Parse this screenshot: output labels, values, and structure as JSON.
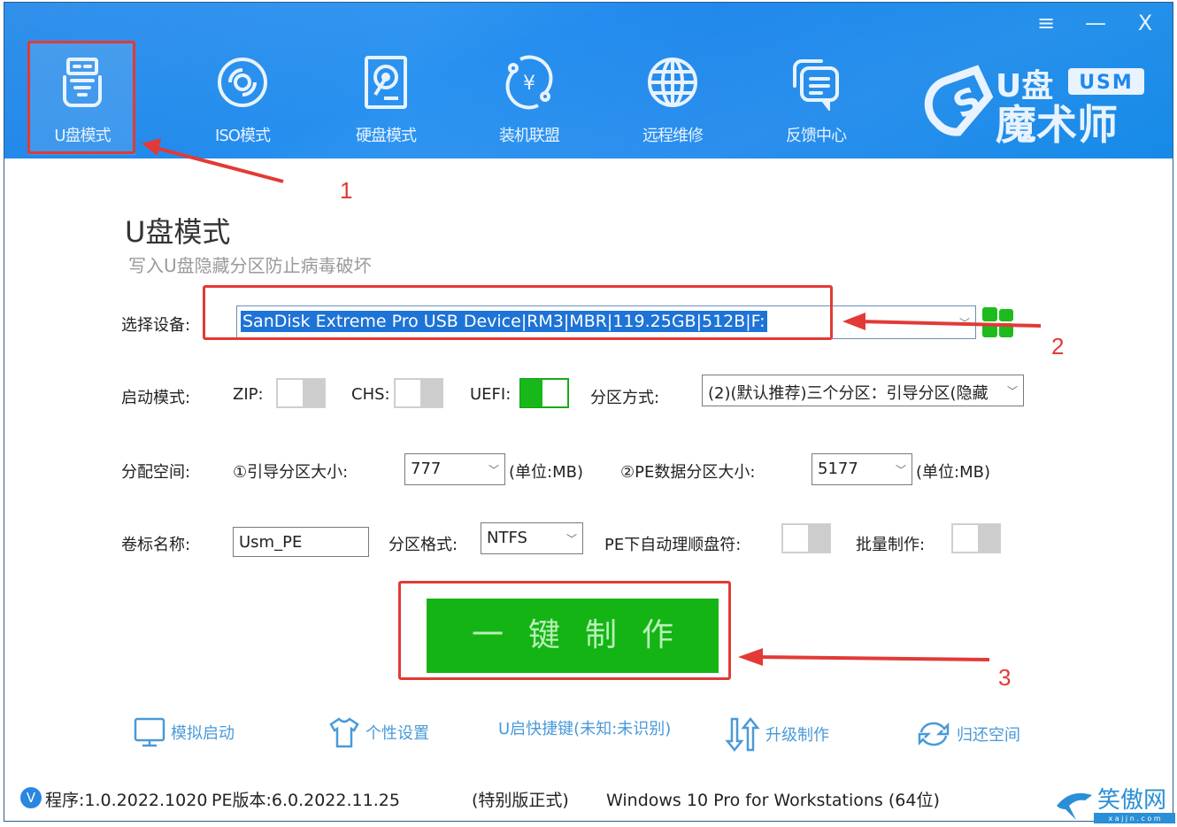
{
  "window": {
    "controls": {
      "menu": "≡",
      "minimize": "—",
      "close": "X"
    }
  },
  "nav": {
    "items": [
      {
        "label": "U盘模式",
        "icon": "usb-drive-icon",
        "active": true
      },
      {
        "label": "ISO模式",
        "icon": "disc-icon",
        "active": false
      },
      {
        "label": "硬盘模式",
        "icon": "hard-disk-icon",
        "active": false
      },
      {
        "label": "装机联盟",
        "icon": "yuan-coin-icon",
        "active": false
      },
      {
        "label": "远程维修",
        "icon": "globe-icon",
        "active": false
      },
      {
        "label": "反馈中心",
        "icon": "chat-bubbles-icon",
        "active": false
      }
    ]
  },
  "logo": {
    "badge": "USM",
    "line1": "U盘",
    "line2": "魔术师"
  },
  "page": {
    "title": "U盘模式",
    "subtitle": "写入U盘隐藏分区防止病毒破坏"
  },
  "form": {
    "device_label": "选择设备:",
    "device_value": "SanDisk Extreme Pro USB Device|RM3|MBR|119.25GB|512B|F:",
    "boot_label": "启动模式:",
    "zip_label": "ZIP:",
    "zip_on": false,
    "chs_label": "CHS:",
    "chs_on": false,
    "uefi_label": "UEFI:",
    "uefi_on": true,
    "partition_mode_label": "分区方式:",
    "partition_mode_value": "(2)(默认推荐)三个分区：引导分区(隐藏",
    "alloc_label": "分配空间:",
    "boot_size_label": "①引导分区大小:",
    "boot_size_value": "777",
    "unit1": "(单位:MB)",
    "pe_size_label": "②PE数据分区大小:",
    "pe_size_value": "5177",
    "unit2": "(单位:MB)",
    "volume_label": "卷标名称:",
    "volume_value": "Usm_PE",
    "fs_label": "分区格式:",
    "fs_value": "NTFS",
    "pe_auto_label": "PE下自动理顺盘符:",
    "pe_auto_on": false,
    "batch_label": "批量制作:",
    "batch_on": false
  },
  "make_button": "一键制作",
  "tools": [
    {
      "label": "模拟启动",
      "icon": "monitor-icon"
    },
    {
      "label": "个性设置",
      "icon": "tshirt-icon"
    },
    {
      "label": "U启快捷键(未知:未识别)",
      "icon": ""
    },
    {
      "label": "升级制作",
      "icon": "up-down-arrows-icon"
    },
    {
      "label": "归还空间",
      "icon": "refresh-icon"
    }
  ],
  "status": {
    "badge": "V",
    "program": "程序:1.0.2022.1020",
    "pe_version": "PE版本:6.0.2022.11.25",
    "edition": "(特别版正式)",
    "os": "Windows 10 Pro for Workstations (64位)"
  },
  "annotations": {
    "step1": "1",
    "step2": "2",
    "step3": "3"
  },
  "watermark": {
    "text": "笑傲网",
    "sub": "x a j j n . c o m"
  },
  "colors": {
    "header_blue": "#1f88ec",
    "accent_green": "#14b414",
    "annotation_red": "#e23a36",
    "selection_blue": "#1e73d6"
  }
}
